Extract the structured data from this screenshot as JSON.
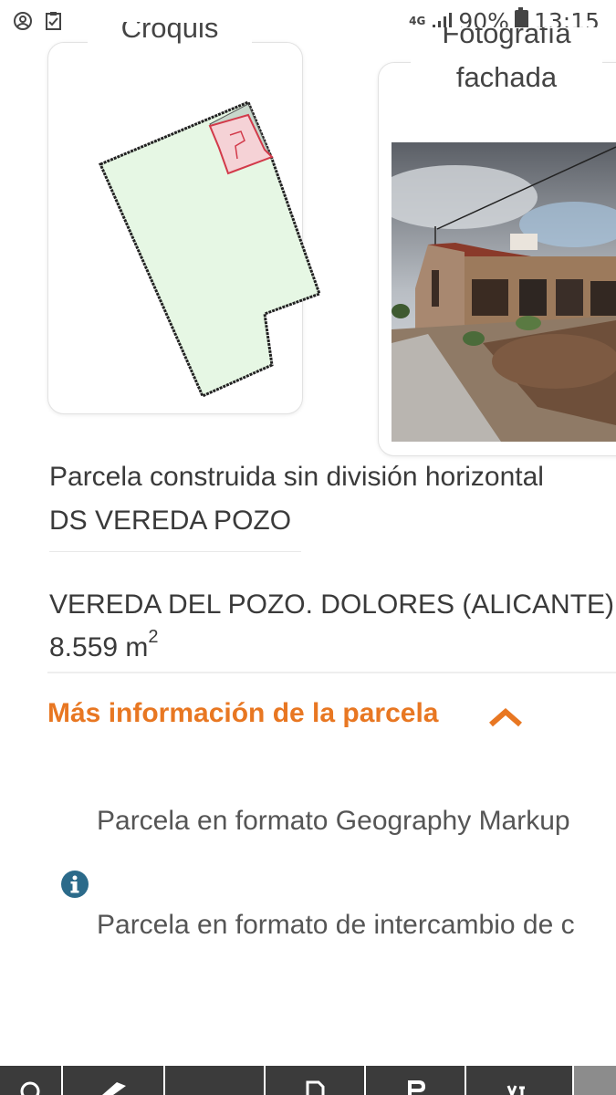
{
  "status_bar": {
    "network": "4G",
    "battery": "90%",
    "time": "13:15"
  },
  "croquis_card": {
    "title": "Croquis"
  },
  "foto_card": {
    "title_line1": "Fotografía",
    "title_line2": "fachada"
  },
  "parcel": {
    "type": "Parcela construida sin división horizontal",
    "reference": "DS VEREDA POZO",
    "address": "VEREDA DEL POZO. DOLORES (ALICANTE)",
    "area_value": "8.559 m",
    "area_unit_exp": "2"
  },
  "more_info": {
    "label": "Más información de la parcela"
  },
  "links": {
    "gml": "Parcela en formato Geography Markup",
    "exchange": "Parcela en formato de intercambio de c"
  },
  "colors": {
    "accent": "#e87722",
    "info_icon": "#2b6a8a",
    "parcel_fill": "#e6f7e4",
    "building_fill": "#f5d2d6",
    "bottom_bar": "#3b3b3b"
  },
  "icons": {
    "status_left": [
      "account-icon",
      "checklist-icon"
    ],
    "info": "info-icon",
    "chevron": "chevron-up-icon"
  }
}
